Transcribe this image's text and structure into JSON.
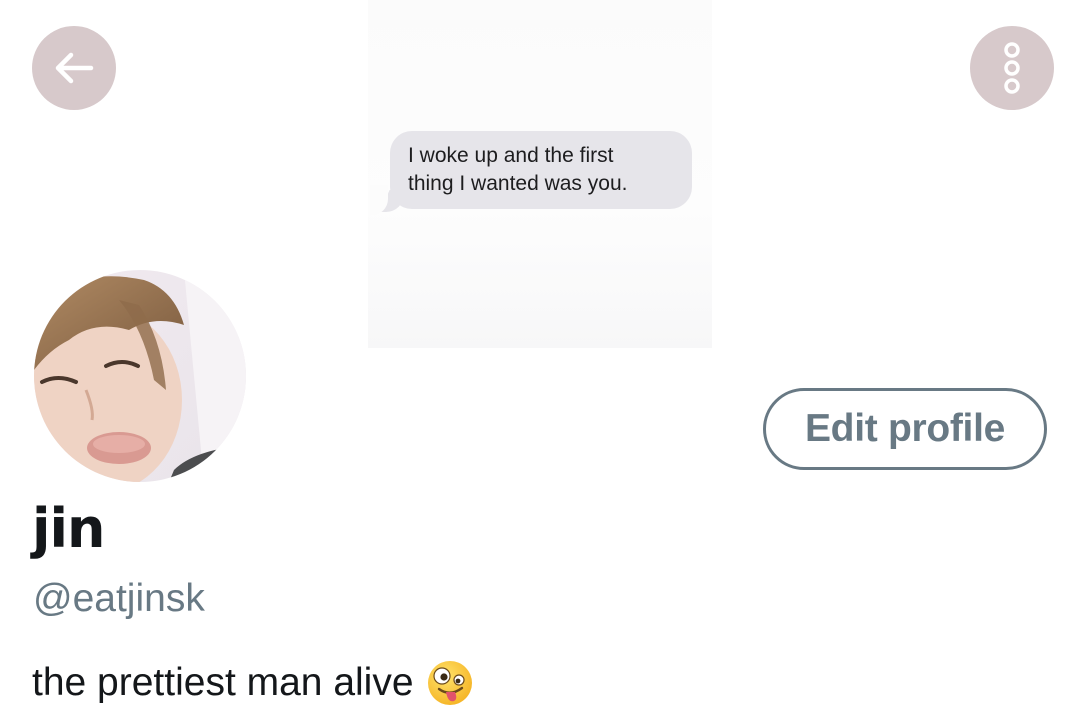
{
  "header": {
    "message_text_line1": "I woke up and the first",
    "message_text_line2": "thing I wanted was you."
  },
  "nav": {
    "back_icon": "arrow-left-icon",
    "more_icon": "more-vertical-icon"
  },
  "profile": {
    "display_name": "jin",
    "handle": "@eatjinsk",
    "bio": "the prettiest man alive",
    "bio_emoji": "zany-face-emoji",
    "edit_label": "Edit profile"
  },
  "colors": {
    "accent_gray": "#687984",
    "nav_button_bg": "#d7c9cb",
    "bubble_bg": "#e6e5ea",
    "text_primary": "#14171a"
  }
}
